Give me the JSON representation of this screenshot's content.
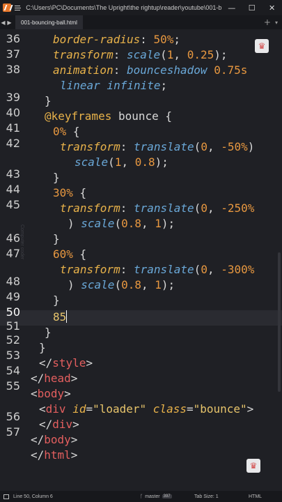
{
  "window": {
    "title": "C:\\Users\\PC\\Documents\\The Upright\\the rightup\\reader\\youtube\\001-bou...",
    "minimize": "—",
    "maximize": "☐",
    "close": "✕"
  },
  "tabs": {
    "back": "◀",
    "forward": "▶",
    "active": "001-bouncing-ball.html",
    "add": "+",
    "list": "▾"
  },
  "editor": {
    "gutter": [
      {
        "num": "36"
      },
      {
        "num": "37"
      },
      {
        "num": "38"
      },
      {
        "num": "39"
      },
      {
        "num": "40"
      },
      {
        "num": "41"
      },
      {
        "num": "42"
      },
      {
        "num": "43"
      },
      {
        "num": "44"
      },
      {
        "num": "45"
      },
      {
        "num": "46"
      },
      {
        "num": "47"
      },
      {
        "num": "48"
      },
      {
        "num": "49"
      },
      {
        "num": "50"
      },
      {
        "num": "51"
      },
      {
        "num": "52"
      },
      {
        "num": "53"
      },
      {
        "num": "54"
      },
      {
        "num": "55"
      },
      {
        "num": "56"
      },
      {
        "num": "57"
      }
    ],
    "lines": [
      {
        "parts": [
          {
            "text": "border-radius",
            "c": "k"
          },
          {
            "text": ": ",
            "c": "p"
          },
          {
            "text": "50%",
            "c": "n"
          },
          {
            "text": ";",
            "c": "p"
          }
        ]
      },
      {
        "parts": [
          {
            "text": "transform",
            "c": "k"
          },
          {
            "text": ": ",
            "c": "p"
          },
          {
            "text": "scale",
            "c": "v"
          },
          {
            "text": "(",
            "c": "p"
          },
          {
            "text": "1",
            "c": "n"
          },
          {
            "text": ", ",
            "c": "p"
          },
          {
            "text": "0.25",
            "c": "n"
          },
          {
            "text": ");",
            "c": "p"
          }
        ]
      },
      {
        "parts": [
          {
            "text": "animation",
            "c": "k"
          },
          {
            "text": ": ",
            "c": "p"
          },
          {
            "text": "bounceshadow",
            "c": "v"
          },
          {
            "text": " ",
            "c": "p"
          },
          {
            "text": "0.75s",
            "c": "n"
          }
        ]
      },
      {
        "parts": [
          {
            "text": "linear infinite",
            "c": "v"
          },
          {
            "text": ";",
            "c": "p"
          }
        ]
      },
      {
        "parts": [
          {
            "text": "}",
            "c": "p"
          }
        ]
      },
      {
        "parts": [
          {
            "text": "@keyframes",
            "c": "at"
          },
          {
            "text": " bounce {",
            "c": "p"
          }
        ]
      },
      {
        "parts": [
          {
            "text": "0%",
            "c": "n"
          },
          {
            "text": " {",
            "c": "p"
          }
        ]
      },
      {
        "parts": [
          {
            "text": "transform",
            "c": "k"
          },
          {
            "text": ": ",
            "c": "p"
          },
          {
            "text": "translate",
            "c": "v"
          },
          {
            "text": "(",
            "c": "p"
          },
          {
            "text": "0",
            "c": "n"
          },
          {
            "text": ", ",
            "c": "p"
          },
          {
            "text": "-50%",
            "c": "n"
          },
          {
            "text": ")",
            "c": "p"
          }
        ]
      },
      {
        "parts": [
          {
            "text": "scale",
            "c": "v"
          },
          {
            "text": "(",
            "c": "p"
          },
          {
            "text": "1",
            "c": "n"
          },
          {
            "text": ", ",
            "c": "p"
          },
          {
            "text": "0.8",
            "c": "n"
          },
          {
            "text": ");",
            "c": "p"
          }
        ]
      },
      {
        "parts": [
          {
            "text": "}",
            "c": "p"
          }
        ]
      },
      {
        "parts": [
          {
            "text": "30%",
            "c": "n"
          },
          {
            "text": " {",
            "c": "p"
          }
        ]
      },
      {
        "parts": [
          {
            "text": "transform",
            "c": "k"
          },
          {
            "text": ": ",
            "c": "p"
          },
          {
            "text": "translate",
            "c": "v"
          },
          {
            "text": "(",
            "c": "p"
          },
          {
            "text": "0",
            "c": "n"
          },
          {
            "text": ", ",
            "c": "p"
          },
          {
            "text": "-250%",
            "c": "n"
          }
        ]
      },
      {
        "parts": [
          {
            "text": ") ",
            "c": "p"
          },
          {
            "text": "scale",
            "c": "v"
          },
          {
            "text": "(",
            "c": "p"
          },
          {
            "text": "0.8",
            "c": "n"
          },
          {
            "text": ", ",
            "c": "p"
          },
          {
            "text": "1",
            "c": "n"
          },
          {
            "text": ");",
            "c": "p"
          }
        ]
      },
      {
        "parts": [
          {
            "text": "}",
            "c": "p"
          }
        ]
      },
      {
        "parts": [
          {
            "text": "60%",
            "c": "n"
          },
          {
            "text": " {",
            "c": "p"
          }
        ]
      },
      {
        "parts": [
          {
            "text": "transform",
            "c": "k"
          },
          {
            "text": ": ",
            "c": "p"
          },
          {
            "text": "translate",
            "c": "v"
          },
          {
            "text": "(",
            "c": "p"
          },
          {
            "text": "0",
            "c": "n"
          },
          {
            "text": ", ",
            "c": "p"
          },
          {
            "text": "-300%",
            "c": "n"
          }
        ]
      },
      {
        "parts": [
          {
            "text": ") ",
            "c": "p"
          },
          {
            "text": "scale",
            "c": "v"
          },
          {
            "text": "(",
            "c": "p"
          },
          {
            "text": "0.8",
            "c": "n"
          },
          {
            "text": ", ",
            "c": "p"
          },
          {
            "text": "1",
            "c": "n"
          },
          {
            "text": ");",
            "c": "p"
          }
        ]
      },
      {
        "parts": [
          {
            "text": "}",
            "c": "p"
          }
        ]
      },
      {
        "parts": [
          {
            "text": "85",
            "c": "s"
          }
        ],
        "cursor": true
      },
      {
        "parts": [
          {
            "text": "}",
            "c": "p"
          }
        ]
      },
      {
        "parts": [
          {
            "text": "}",
            "c": "p"
          }
        ]
      },
      {
        "parts": [
          {
            "text": "</",
            "c": "p"
          },
          {
            "text": "style",
            "c": "t"
          },
          {
            "text": ">",
            "c": "p"
          }
        ]
      },
      {
        "parts": [
          {
            "text": "</",
            "c": "p"
          },
          {
            "text": "head",
            "c": "t"
          },
          {
            "text": ">",
            "c": "p"
          }
        ]
      },
      {
        "parts": [
          {
            "text": "<",
            "c": "p"
          },
          {
            "text": "body",
            "c": "t"
          },
          {
            "text": ">",
            "c": "p"
          }
        ]
      },
      {
        "parts": [
          {
            "text": "<",
            "c": "p"
          },
          {
            "text": "div",
            "c": "t"
          },
          {
            "text": " ",
            "c": "p"
          },
          {
            "text": "id",
            "c": "a"
          },
          {
            "text": "=",
            "c": "p"
          },
          {
            "text": "\"loader\"",
            "c": "s"
          },
          {
            "text": " ",
            "c": "p"
          },
          {
            "text": "class",
            "c": "a"
          },
          {
            "text": "=",
            "c": "p"
          },
          {
            "text": "\"bounce\"",
            "c": "s"
          },
          {
            "text": ">",
            "c": "p"
          }
        ]
      },
      {
        "parts": [
          {
            "text": "</",
            "c": "p"
          },
          {
            "text": "div",
            "c": "t"
          },
          {
            "text": ">",
            "c": "p"
          }
        ]
      },
      {
        "parts": [
          {
            "text": "</",
            "c": "p"
          },
          {
            "text": "body",
            "c": "t"
          },
          {
            "text": ">",
            "c": "p"
          }
        ]
      },
      {
        "parts": [
          {
            "text": "</",
            "c": "p"
          },
          {
            "text": "html",
            "c": "t"
          },
          {
            "text": ">",
            "c": "p"
          }
        ]
      }
    ],
    "watermark": "Computer coder"
  },
  "badges": {
    "top": "♛",
    "bottom": "♛"
  },
  "status": {
    "position": "Line 50, Column 6",
    "branch_icon": "ᚴ",
    "branch": "master",
    "branch_count": "397",
    "tab_size": "Tab Size: 1",
    "syntax": "HTML"
  },
  "colors": {
    "background": "#1f2025",
    "accent": "#e8782c"
  }
}
